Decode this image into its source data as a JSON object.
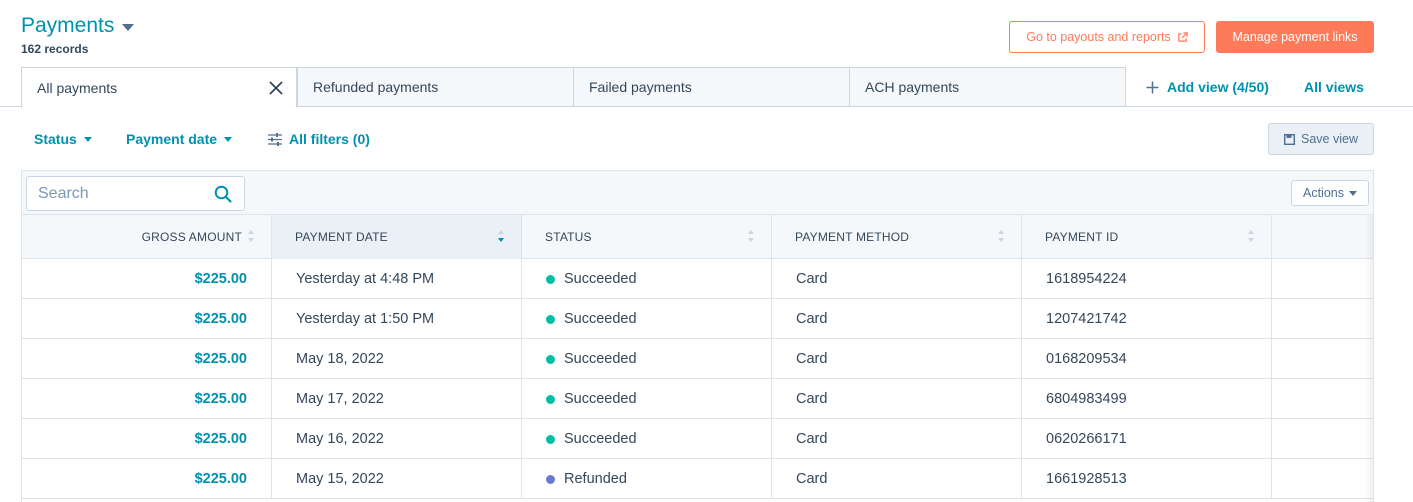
{
  "header": {
    "title": "Payments",
    "record_count": "162 records",
    "payouts_button": "Go to payouts and reports",
    "manage_links_button": "Manage payment links"
  },
  "tabs": [
    {
      "label": "All payments"
    },
    {
      "label": "Refunded payments"
    },
    {
      "label": "Failed payments"
    },
    {
      "label": "ACH payments"
    }
  ],
  "views": {
    "add_view": "Add view (4/50)",
    "all_views": "All views"
  },
  "filters": {
    "status": "Status",
    "payment_date": "Payment date",
    "all_filters": "All filters (0)",
    "save_view": "Save view"
  },
  "table": {
    "search_placeholder": "Search",
    "actions_label": "Actions",
    "columns": [
      "GROSS AMOUNT",
      "PAYMENT DATE",
      "STATUS",
      "PAYMENT METHOD",
      "PAYMENT ID"
    ],
    "rows": [
      {
        "amount": "$225.00",
        "date": "Yesterday at 4:48 PM",
        "status": "Succeeded",
        "method": "Card",
        "id": "1618954224"
      },
      {
        "amount": "$225.00",
        "date": "Yesterday at 1:50 PM",
        "status": "Succeeded",
        "method": "Card",
        "id": "1207421742"
      },
      {
        "amount": "$225.00",
        "date": "May 18, 2022",
        "status": "Succeeded",
        "method": "Card",
        "id": "0168209534"
      },
      {
        "amount": "$225.00",
        "date": "May 17, 2022",
        "status": "Succeeded",
        "method": "Card",
        "id": "6804983499"
      },
      {
        "amount": "$225.00",
        "date": "May 16, 2022",
        "status": "Succeeded",
        "method": "Card",
        "id": "0620266171"
      },
      {
        "amount": "$225.00",
        "date": "May 15, 2022",
        "status": "Refunded",
        "method": "Card",
        "id": "1661928513"
      }
    ]
  },
  "colors": {
    "accent": "#0091ae",
    "cta": "#ff7a59",
    "succeeded": "#00bda5",
    "refunded": "#6a78d1"
  }
}
